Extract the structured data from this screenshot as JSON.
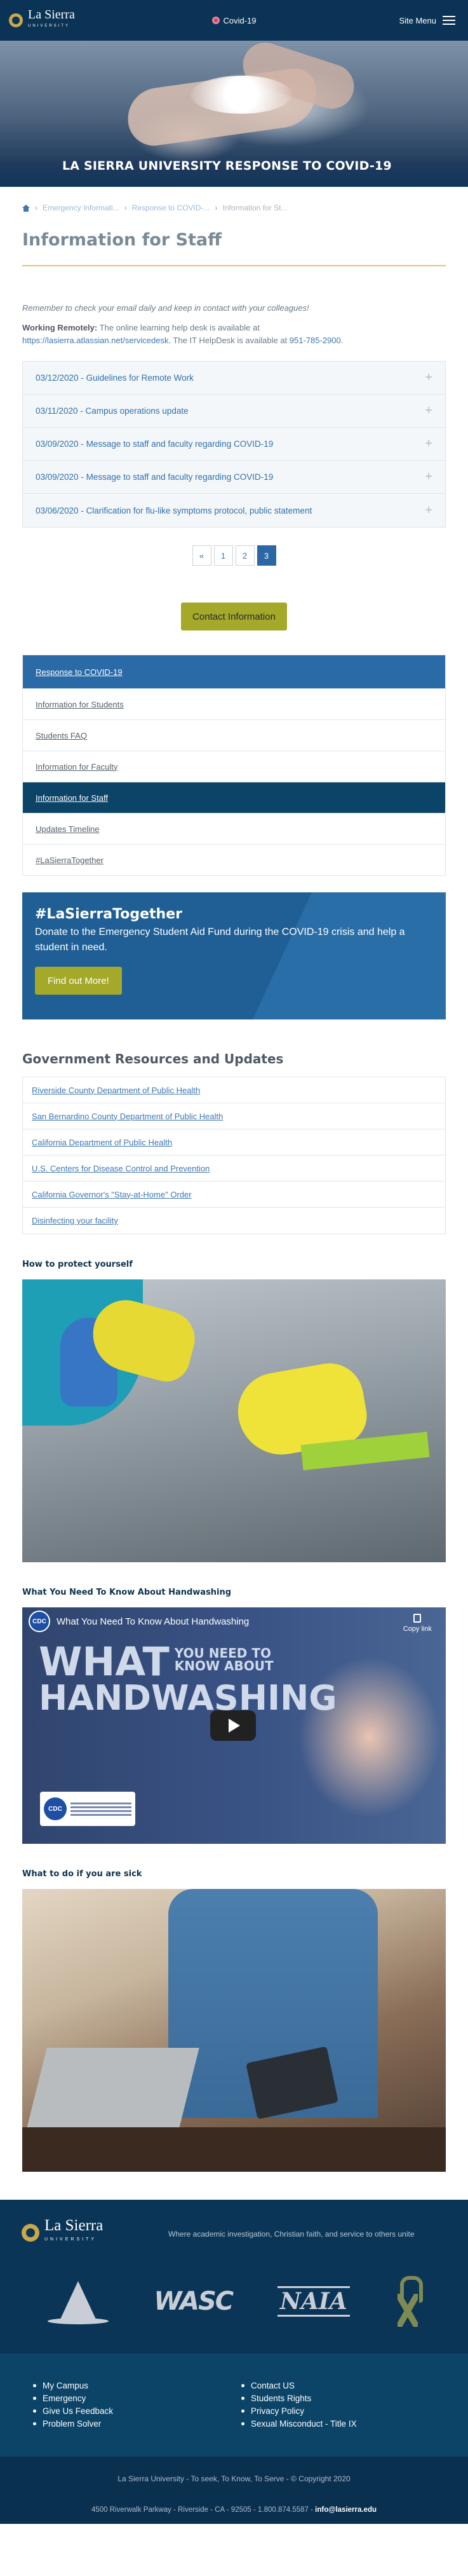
{
  "header": {
    "logo_text": "La Sierra",
    "logo_sub": "UNIVERSITY",
    "covid_link": "Covid-19",
    "menu_label": "Site Menu"
  },
  "hero": {
    "title": "LA SIERRA UNIVERSITY RESPONSE TO COVID-19"
  },
  "breadcrumb": {
    "items": [
      "Emergency Informati...",
      "Response to COVID-...",
      "Information for St..."
    ]
  },
  "page": {
    "title": "Information for Staff",
    "reminder": "Remember to check your email daily and keep in contact with your colleagues!",
    "working_label": "Working Remotely:",
    "working_text_1": "The online learning help desk is available at",
    "working_link": "https://lasierra.atlassian.net/servicedesk",
    "working_text_2": ". The IT HelpDesk is available at",
    "phone": "951-785-2900",
    "period": "."
  },
  "accordion": [
    "03/12/2020 - Guidelines for Remote Work",
    "03/11/2020 - Campus operations update",
    "03/09/2020 - Message to staff and faculty regarding COVID-19",
    "03/09/2020 - Message to staff and faculty regarding COVID-19",
    "03/06/2020 - Clarification for flu-like symptoms protocol, public statement"
  ],
  "pager": {
    "prev": "«",
    "pages": [
      "1",
      "2",
      "3"
    ],
    "active": "3"
  },
  "contact_button": "Contact Information",
  "sidenav": {
    "head": "Response to COVID-19",
    "items": [
      "Information for Students",
      "Students FAQ",
      "Information for Faculty",
      "Information for Staff",
      "Updates Timeline",
      "#LaSierraTogether"
    ],
    "active_index": 3
  },
  "donate": {
    "title": "#LaSierraTogether",
    "text": "Donate to the Emergency Student Aid Fund during the COVID-19 crisis and help a student in need.",
    "button": "Find out More!"
  },
  "gov": {
    "title": "Government Resources and Updates",
    "links": [
      "Riverside County Department of Public Health",
      "San Bernardino County Department of Public Health",
      "California Department of Public Health",
      "U.S. Centers for Disease Control and Prevention",
      "California Governor's \"Stay-at-Home\" Order",
      "Disinfecting your facility"
    ]
  },
  "media": {
    "protect_title": "How to protect yourself",
    "handwashing_title": "What You Need To Know About Handwashing",
    "sick_title": "What to do if you are sick"
  },
  "video": {
    "channel": "CDC",
    "title": "What You Need To Know About Handwashing",
    "copy_link": "Copy link",
    "big_word_1": "WHAT",
    "big_sub": "YOU NEED TO\nKNOW ABOUT",
    "big_word_2": "HANDWASHING"
  },
  "footer": {
    "logo_text": "La Sierra",
    "logo_sub": "UNIVERSITY",
    "tagline": "Where academic investigation, Christian faith, and service to others unite",
    "partners": [
      "WASC",
      "NAIA"
    ],
    "col1": [
      "My Campus",
      "Emergency",
      "Give Us Feedback",
      "Problem Solver"
    ],
    "col2": [
      "Contact US",
      "Students Rights",
      "Privacy Policy",
      "Sexual Misconduct - Title IX"
    ],
    "copyright": "La Sierra University - To seek, To Know, To Serve - © Copyright 2020",
    "address": "4500 Riverwalk Parkway - Riverside - CA - 92505 - 1.800.874.5587 - ",
    "email": "info@lasierra.edu"
  },
  "colors": {
    "navy": "#0a3355",
    "accent_blue": "#2a6aa6",
    "olive": "#a5a92a",
    "gold_rule": "#e8c463"
  }
}
